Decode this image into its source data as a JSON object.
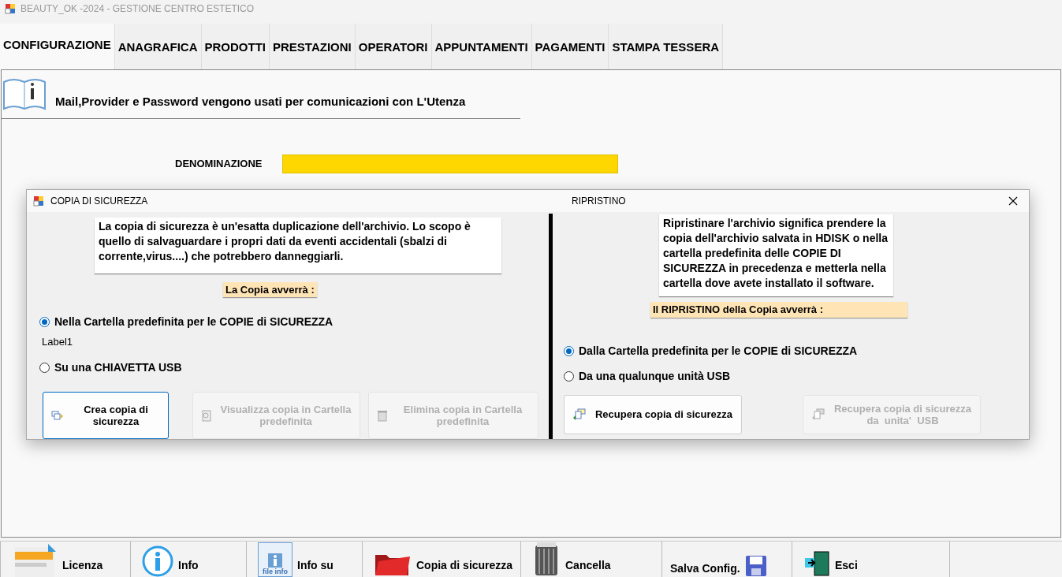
{
  "window": {
    "title": "BEAUTY_OK  -2024 -   GESTIONE CENTRO ESTETICO"
  },
  "tabs": [
    {
      "label": "CONFIGURAZIONE",
      "selected": true
    },
    {
      "label": "ANAGRAFICA",
      "selected": false
    },
    {
      "label": "PRODOTTI",
      "selected": false
    },
    {
      "label": "PRESTAZIONI",
      "selected": false
    },
    {
      "label": "OPERATORI",
      "selected": false
    },
    {
      "label": "APPUNTAMENTI",
      "selected": false
    },
    {
      "label": "PAGAMENTI",
      "selected": false
    },
    {
      "label": "STAMPA TESSERA",
      "selected": false
    }
  ],
  "info_banner": {
    "text": "Mail,Provider e Password vengono usati per comunicazioni con L'Utenza"
  },
  "denominazione": {
    "label": "DENOMINAZIONE"
  },
  "dialog": {
    "title": "COPIA DI SICUREZZA",
    "subtitle": "RIPRISTINO",
    "backup": {
      "description": "La copia di sicurezza è un'esatta duplicazione dell'archivio. Lo scopo è quello di salvaguardare i propri dati da eventi accidentali (sbalzi di corrente,virus....) che potrebbero danneggiarli.",
      "heading": "La Copia avverrà :",
      "options": [
        {
          "label": "Nella Cartella predefinita per le COPIE di SICUREZZA",
          "selected": true,
          "note": "Label1"
        },
        {
          "label": "Su una CHIAVETTA USB",
          "selected": false
        }
      ],
      "buttons": [
        {
          "label": "Crea copia di sicurezza",
          "disabled": false,
          "focused": true,
          "kind": "create"
        },
        {
          "label": "Visualizza copia in Cartella predefinita",
          "disabled": true,
          "focused": false,
          "kind": "view"
        },
        {
          "label": "Elimina copia in Cartella predefinita",
          "disabled": true,
          "focused": false,
          "kind": "delete"
        }
      ]
    },
    "restore": {
      "description": "Ripristinare l'archivio significa prendere la copia dell'archivio salvata in HDISK o nella cartella predefinita delle COPIE DI SICUREZZA in precedenza e metterla nella cartella dove avete installato il software.",
      "heading": "Il RIPRISTINO della Copia avverrà :",
      "options": [
        {
          "label": "Dalla Cartella predefinita per le COPIE di SICUREZZA",
          "selected": true
        },
        {
          "label": "Da una qualunque unità USB",
          "selected": false
        }
      ],
      "buttons": [
        {
          "label": "Recupera copia di sicurezza",
          "disabled": false,
          "focused": false,
          "kind": "restore"
        },
        {
          "label": "Recupera copia di sicurezza da  unita'  USB",
          "disabled": true,
          "focused": false,
          "kind": "restore"
        }
      ]
    }
  },
  "toolbar": [
    {
      "label": "Licenza",
      "kind": "license"
    },
    {
      "label": "Info",
      "kind": "info"
    },
    {
      "label": "Info su",
      "kind": "fileinfo",
      "icon_text": "file info"
    },
    {
      "label": "Copia di sicurezza",
      "kind": "folder"
    },
    {
      "label": "Cancella",
      "kind": "trash"
    },
    {
      "label": "Salva Config.",
      "kind": "save"
    },
    {
      "label": "Esci",
      "kind": "exit"
    }
  ]
}
